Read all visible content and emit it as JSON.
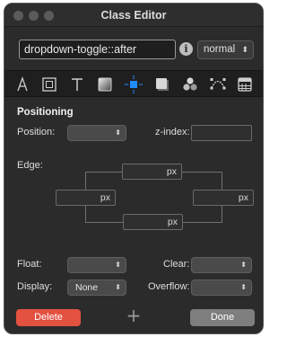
{
  "window": {
    "title": "Class Editor"
  },
  "toolbar": {
    "selector_value": "dropdown-toggle::after",
    "info_icon": "info-icon",
    "state_select": {
      "selected": "normal"
    }
  },
  "tabs": [
    {
      "icon": "typography-tool-icon"
    },
    {
      "icon": "border-square-icon"
    },
    {
      "icon": "text-t-icon"
    },
    {
      "icon": "background-gradient-icon"
    },
    {
      "icon": "positioning-crosshair-icon",
      "active": true
    },
    {
      "icon": "shadow-box-icon"
    },
    {
      "icon": "effects-circles-icon"
    },
    {
      "icon": "transform-bezier-icon"
    },
    {
      "icon": "calculator-table-icon"
    }
  ],
  "positioning": {
    "title": "Positioning",
    "position_label": "Position:",
    "position_value": "",
    "zindex_label": "z-index:",
    "zindex_value": "",
    "edge_label": "Edge:",
    "edge_top_unit": "px",
    "edge_left_unit": "px",
    "edge_right_unit": "px",
    "edge_bottom_unit": "px",
    "float_label": "Float:",
    "float_value": "",
    "clear_label": "Clear:",
    "clear_value": "",
    "display_label": "Display:",
    "display_value": "None",
    "overflow_label": "Overflow:",
    "overflow_value": ""
  },
  "footer": {
    "delete_label": "Delete",
    "add_symbol": "+",
    "done_label": "Done"
  },
  "colors": {
    "accent_active": "#1e8cff",
    "delete": "#e35141",
    "done": "#7e7e7e",
    "background": "#2b2b2b"
  }
}
